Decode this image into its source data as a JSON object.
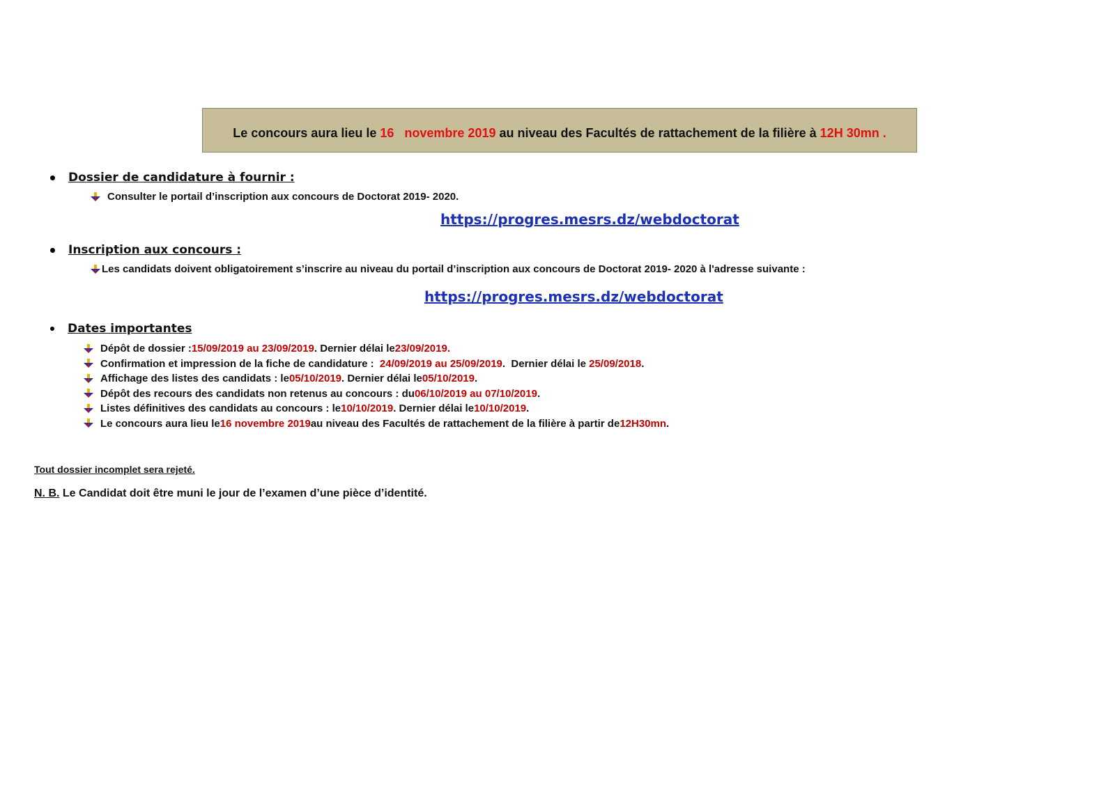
{
  "banner": {
    "part1": "Le concours aura lieu le ",
    "day": "16",
    "month_year": "novembre 2019",
    "part2": " au niveau des Facultés de rattachement de la filière à ",
    "time": "12H 30mn ."
  },
  "sections": {
    "dossier": {
      "title": "Dossier de candidature à fournir :",
      "item": "Consulter le portail d’inscription aux concours de Doctorat 2019- 2020.",
      "link": "https://progres.mesrs.dz/webdoctorat"
    },
    "inscription": {
      "title": "Inscription aux concours :",
      "item": "Les candidats doivent obligatoirement s’inscrire au niveau du portail d’inscription aux concours de Doctorat 2019- 2020 à l'adresse suivante :",
      "link": "https://progres.mesrs.dz/webdoctorat"
    },
    "dates": {
      "title": "Dates importantes",
      "items": [
        {
          "a": "Dépôt de dossier : ",
          "b": "15/09/2019 au 23/09/2019",
          "c": ". Dernier délai le ",
          "d": "23/09/2019.",
          "e": ""
        },
        {
          "a": "Confirmation et impression de la fiche de candidature :  ",
          "b": "24/09/2019 au 25/09/2019",
          "c": ".  Dernier délai le ",
          "d": "25/09/2018",
          "e": "."
        },
        {
          "a": "Affichage des listes des candidats : le ",
          "b": "05/10/2019",
          "c": ". Dernier délai le ",
          "d": "05/10/2019",
          "e": "."
        },
        {
          "a": "Dépôt des recours des candidats non retenus au concours : du ",
          "b": "06/10/2019 au 07/10/2019",
          "c": ".",
          "d": "",
          "e": ""
        },
        {
          "a": "Listes définitives des candidats au concours : le ",
          "b": "10/10/2019",
          "c": ". Dernier délai le ",
          "d": "10/10/2019",
          "e": "."
        },
        {
          "a": "Le concours aura lieu le ",
          "b": "16 novembre 2019",
          "c": " au niveau des Facultés de rattachement de la filière à partir de ",
          "d": "12H30mn",
          "e": "."
        }
      ]
    }
  },
  "notes": {
    "rejection": "Tout dossier incomplet sera rejeté.",
    "nb_label": "N. B.",
    "nb_text": " Le Candidat doit être muni le jour de l’examen d’une pièce d’identité."
  },
  "colors": {
    "banner_bg": "#c7bd99",
    "accent_red": "#e0120f",
    "link_blue": "#1c2fb5"
  }
}
